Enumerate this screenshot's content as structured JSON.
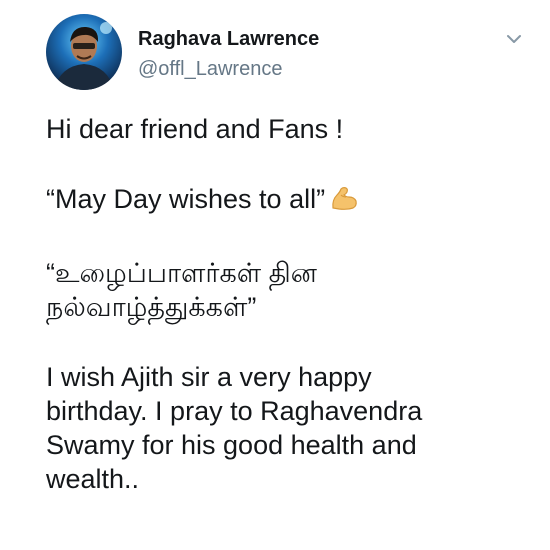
{
  "author": {
    "display_name": "Raghava Lawrence",
    "handle": "@offl_Lawrence",
    "avatar_icon": "profile-photo",
    "menu_icon": "chevron-down-icon"
  },
  "tweet": {
    "line_greeting": "Hi dear friend and Fans !",
    "line_mayday": "“May Day wishes to all”",
    "mayday_emoji": "flexed-biceps-emoji",
    "tamil_line_1": "“உழைப்பாளர்கள் தின",
    "tamil_line_2": "நல்வாழ்த்துக்கள்”",
    "birthday_line_1": "I wish Ajith sir a very happy",
    "birthday_line_2": "birthday. I pray to Raghavendra",
    "birthday_line_3": "Swamy for his good health and",
    "birthday_line_4": "wealth.."
  },
  "colors": {
    "text_primary": "#14171a",
    "text_secondary": "#657786",
    "chevron": "#8899a6",
    "background": "#ffffff"
  }
}
